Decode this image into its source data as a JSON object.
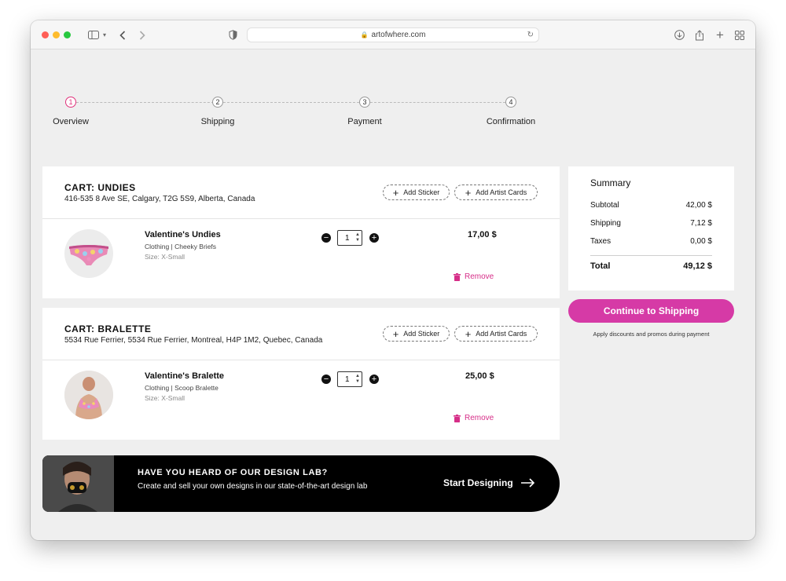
{
  "browser": {
    "url": "artofwhere.com",
    "lights": {
      "close": "#ff5f57",
      "minimize": "#febc2e",
      "zoom": "#28c840"
    }
  },
  "steps": [
    {
      "number": "1",
      "label": "Overview",
      "active": true
    },
    {
      "number": "2",
      "label": "Shipping",
      "active": false
    },
    {
      "number": "3",
      "label": "Payment",
      "active": false
    },
    {
      "number": "4",
      "label": "Confirmation",
      "active": false
    }
  ],
  "carts": [
    {
      "title": "CART: UNDIES",
      "address": "416-535 8 Ave SE, Calgary, T2G 5S9, Alberta, Canada",
      "add_sticker": "Add Sticker",
      "add_artist_cards": "Add Artist Cards",
      "item": {
        "name": "Valentine's Undies",
        "category": "Clothing | Cheeky Briefs",
        "size": "Size: X-Small",
        "quantity": "1",
        "price": "17,00 $",
        "remove": "Remove",
        "image_icon": "undies-thumbnail"
      }
    },
    {
      "title": "CART: BRALETTE",
      "address": "5534 Rue Ferrier, 5534 Rue Ferrier, Montreal, H4P 1M2, Quebec, Canada",
      "add_sticker": "Add Sticker",
      "add_artist_cards": "Add Artist Cards",
      "item": {
        "name": "Valentine's Bralette",
        "category": "Clothing | Scoop Bralette",
        "size": "Size: X-Small",
        "quantity": "1",
        "price": "25,00 $",
        "remove": "Remove",
        "image_icon": "bralette-thumbnail"
      }
    }
  ],
  "summary": {
    "title": "Summary",
    "subtotal_label": "Subtotal",
    "subtotal": "42,00 $",
    "shipping_label": "Shipping",
    "shipping": "7,12 $",
    "taxes_label": "Taxes",
    "taxes": "0,00 $",
    "total_label": "Total",
    "total": "49,12 $",
    "cta": "Continue to Shipping",
    "note": "Apply discounts and promos during payment"
  },
  "banner": {
    "heading": "HAVE YOU HEARD OF OUR DESIGN LAB?",
    "text": "Create and sell your own designs in our state-of-the-art design lab",
    "cta": "Start Designing"
  },
  "colors": {
    "accent": "#d63aa6",
    "remove": "#d62e88",
    "step_active": "#e0307a"
  }
}
